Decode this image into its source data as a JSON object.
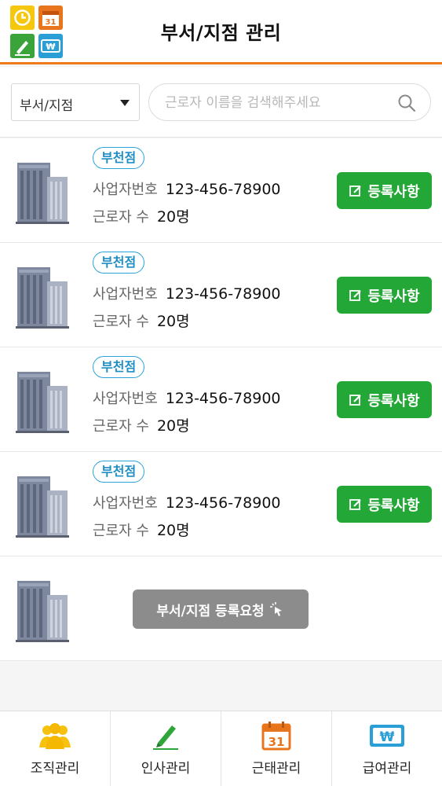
{
  "header": {
    "title": "부서/지점 관리",
    "logo_icon": "app-logo-icon"
  },
  "filter": {
    "select_value": "부서/지점",
    "search_placeholder": "근로자 이름을 검색해주세요"
  },
  "branches": [
    {
      "badge": "부천점",
      "biz_label": "사업자번호",
      "biz_no": "123-456-78900",
      "count_label": "근로자 수",
      "count": "20명",
      "button": "등록사항"
    },
    {
      "badge": "부천점",
      "biz_label": "사업자번호",
      "biz_no": "123-456-78900",
      "count_label": "근로자 수",
      "count": "20명",
      "button": "등록사항"
    },
    {
      "badge": "부천점",
      "biz_label": "사업자번호",
      "biz_no": "123-456-78900",
      "count_label": "근로자 수",
      "count": "20명",
      "button": "등록사항"
    },
    {
      "badge": "부천점",
      "biz_label": "사업자번호",
      "biz_no": "123-456-78900",
      "count_label": "근로자 수",
      "count": "20명",
      "button": "등록사항"
    }
  ],
  "request": {
    "label": "부서/지점 등록요청"
  },
  "nav": [
    {
      "label": "조직관리",
      "icon": "people-icon"
    },
    {
      "label": "인사관리",
      "icon": "pen-icon"
    },
    {
      "label": "근태관리",
      "icon": "calendar-icon"
    },
    {
      "label": "급여관리",
      "icon": "won-icon"
    }
  ],
  "colors": {
    "accent": "#f07a1a",
    "green": "#23a737",
    "badge_blue": "#2aa3d8",
    "gray_button": "#8c8c8c"
  }
}
